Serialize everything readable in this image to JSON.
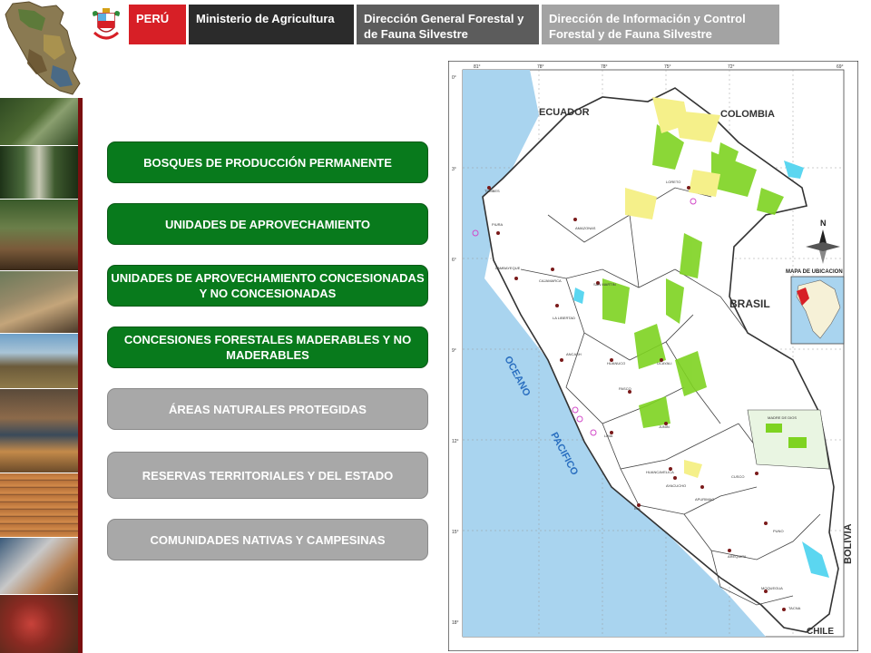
{
  "header": {
    "peru_label": "PERÚ",
    "ministry": "Ministerio de Agricultura",
    "dgffs": "Dirección General Forestal y de Fauna Silvestre",
    "dicffs": "Dirección de Información y Control Forestal y de Fauna Silvestre",
    "colors": {
      "peru": "#d71f26",
      "ministry": "#2b2b2b",
      "dgffs": "#5c5c5c",
      "dicffs": "#a3a3a3"
    }
  },
  "menu": {
    "items": [
      {
        "label": "BOSQUES DE PRODUCCIÓN PERMANENTE",
        "state": "green"
      },
      {
        "label": "UNIDADES DE APROVECHAMIENTO",
        "state": "green"
      },
      {
        "label": "UNIDADES DE APROVECHAMIENTO CONCESIONADAS Y NO CONCESIONADAS",
        "state": "green"
      },
      {
        "label": "CONCESIONES FORESTALES MADERABLES Y NO MADERABLES",
        "state": "green"
      },
      {
        "label": "ÁREAS NATURALES PROTEGIDAS",
        "state": "gray"
      },
      {
        "label": "RESERVAS TERRITORIALES Y DEL ESTADO",
        "state": "gray"
      },
      {
        "label": "COMUNIDADES NATIVAS Y CAMPESINAS",
        "state": "gray"
      }
    ],
    "colors": {
      "green": "#087a1c",
      "gray": "#a8a8a8"
    }
  },
  "map": {
    "countries": {
      "ecuador": "ECUADOR",
      "colombia": "COLOMBIA",
      "brasil": "BRASIL",
      "bolivia": "BOLIVIA",
      "chile": "CHILE"
    },
    "ocean": [
      "OCEANO",
      "PACIFICO"
    ],
    "location_map_title": "MAPA DE UBICACION",
    "north_label": "N",
    "longitudes": [
      "81°",
      "78°",
      "78°",
      "75°",
      "72°",
      "69°"
    ],
    "latitudes": [
      "0°",
      "3°",
      "6°",
      "9°",
      "12°",
      "15°",
      "18°"
    ],
    "regions": [
      "TUMBES",
      "PIURA",
      "LAMBAYEQUE",
      "CAJAMARCA",
      "AMAZONAS",
      "LORETO",
      "SAN MARTIN",
      "LA LIBERTAD",
      "ANCASH",
      "HUANUCO",
      "UCAYALI",
      "PASCO",
      "LIMA",
      "JUNIN",
      "HUANCAVELICA",
      "ICA",
      "AYACUCHO",
      "APURIMAC",
      "CUSCO",
      "MADRE DE DIOS",
      "PUNO",
      "AREQUIPA",
      "MOQUEGUA",
      "TACNA"
    ],
    "colors": {
      "sea": "#a9d4ef",
      "land": "#ffffff",
      "forest": "#7ed321",
      "yellow": "#f5f08a",
      "lake": "#5bd6f0"
    }
  }
}
